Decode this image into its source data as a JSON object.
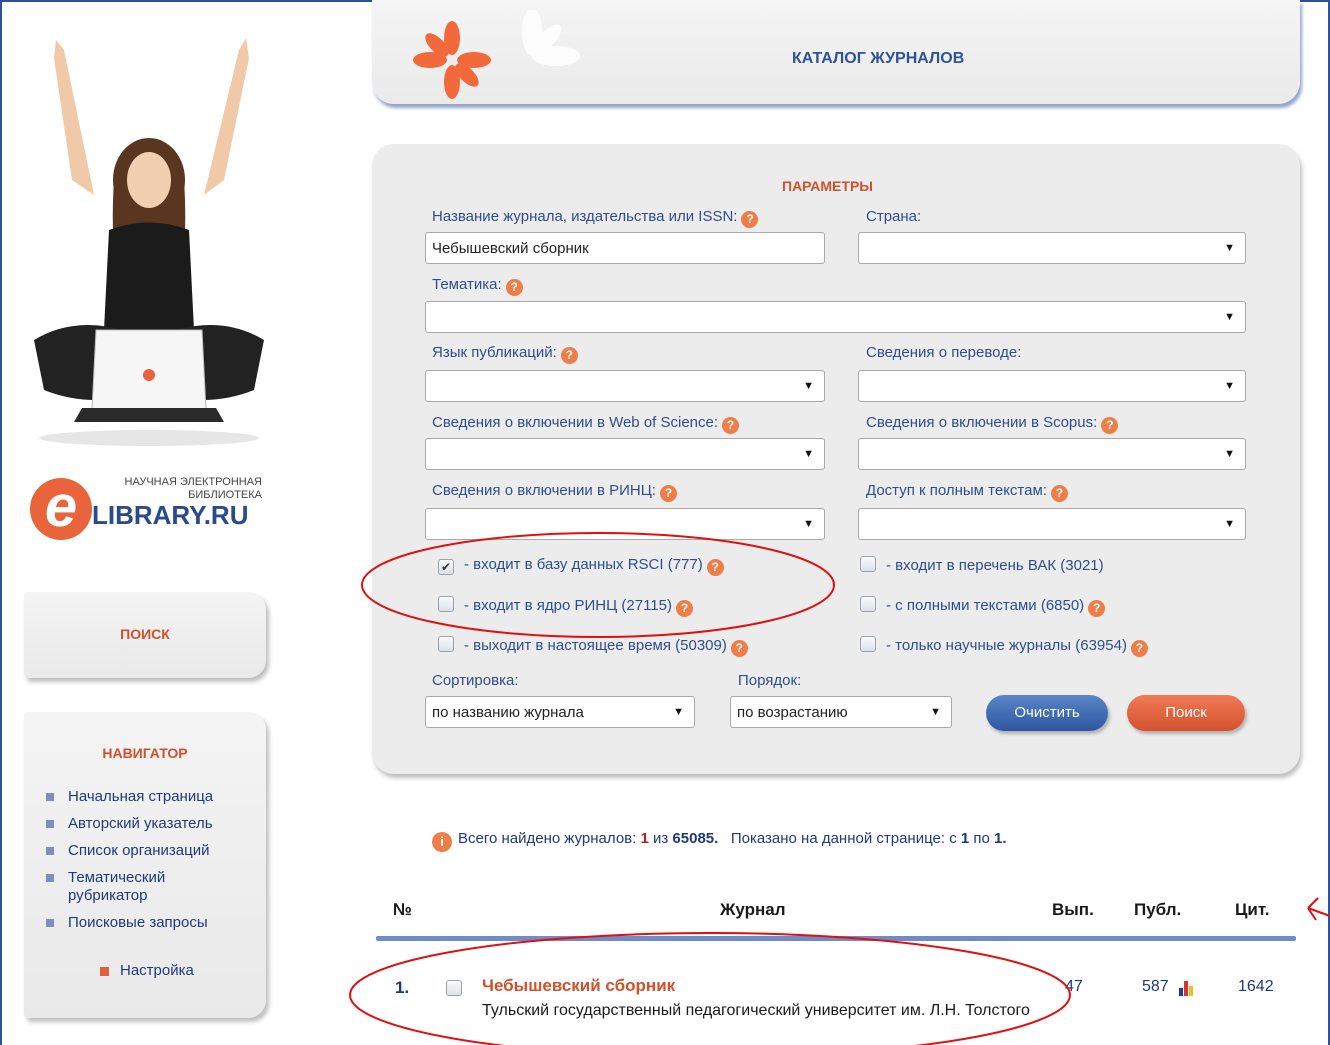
{
  "header": {
    "title": "КАТАЛОГ ЖУРНАЛОВ"
  },
  "logo": {
    "letter": "e",
    "top_line1": "НАУЧНАЯ ЭЛЕКТРОННАЯ",
    "top_line2": "БИБЛИОТЕКА",
    "main": "LIBRARY.RU"
  },
  "sidebar": {
    "search_label": "ПОИСК",
    "navigator_title": "НАВИГАТОР",
    "nav_items": [
      {
        "label": "Начальная страница"
      },
      {
        "label": "Авторский указатель"
      },
      {
        "label": "Список организаций"
      },
      {
        "label": "Тематический рубрикатор"
      },
      {
        "label": "Поисковые запросы"
      }
    ],
    "settings_label": "Настройка"
  },
  "params": {
    "title": "ПАРАМЕТРЫ",
    "journal_name_label": "Название журнала, издательства или ISSN:",
    "journal_name_value": "Чебышевский сборник",
    "country_label": "Страна:",
    "country_value": "",
    "topic_label": "Тематика:",
    "topic_value": "",
    "language_label": "Язык публикаций:",
    "language_value": "",
    "translation_label": "Сведения о переводе:",
    "translation_value": "",
    "wos_label": "Сведения о включении в Web of Science:",
    "wos_value": "",
    "scopus_label": "Сведения о включении в Scopus:",
    "scopus_value": "",
    "rinc_label": "Сведения о включении в РИНЦ:",
    "rinc_value": "",
    "fulltext_access_label": "Доступ к полным текстам:",
    "fulltext_access_value": "",
    "checkboxes": {
      "rsci": {
        "label": "- входит в базу данных RSCI (777)",
        "checked": true
      },
      "core_rinc": {
        "label": "- входит в ядро РИНЦ (27115)",
        "checked": false
      },
      "current": {
        "label": "- выходит в настоящее время (50309)",
        "checked": false
      },
      "vak": {
        "label": "- входит в перечень ВАК (3021)",
        "checked": false
      },
      "fulltexts": {
        "label": "- с полными текстами (6850)",
        "checked": false
      },
      "scientific": {
        "label": "- только научные журналы (63954)",
        "checked": false
      }
    },
    "sort_label": "Сортировка:",
    "sort_value": "по названию журнала",
    "order_label": "Порядок:",
    "order_value": "по возрастанию",
    "clear_button": "Очистить",
    "search_button": "Поиск"
  },
  "results": {
    "info_prefix": "Всего найдено журналов:",
    "found": "1",
    "of_word": "из",
    "total": "65085.",
    "shown_prefix": "Показано на данной странице: с",
    "from": "1",
    "to_word": "по",
    "to": "1.",
    "columns": {
      "num": "№",
      "journal": "Журнал",
      "issues": "Вып.",
      "publications": "Публ.",
      "citations": "Цит."
    },
    "rows": [
      {
        "num": "1.",
        "title": "Чебышевский сборник",
        "publisher": "Тульский государственный педагогический университет им. Л.Н. Толстого",
        "issues": "47",
        "publications": "587",
        "citations": "1642"
      }
    ]
  },
  "colors": {
    "accent_orange": "#d2512c",
    "link_blue": "#1f3a7a",
    "annotation_red": "#e01010"
  }
}
